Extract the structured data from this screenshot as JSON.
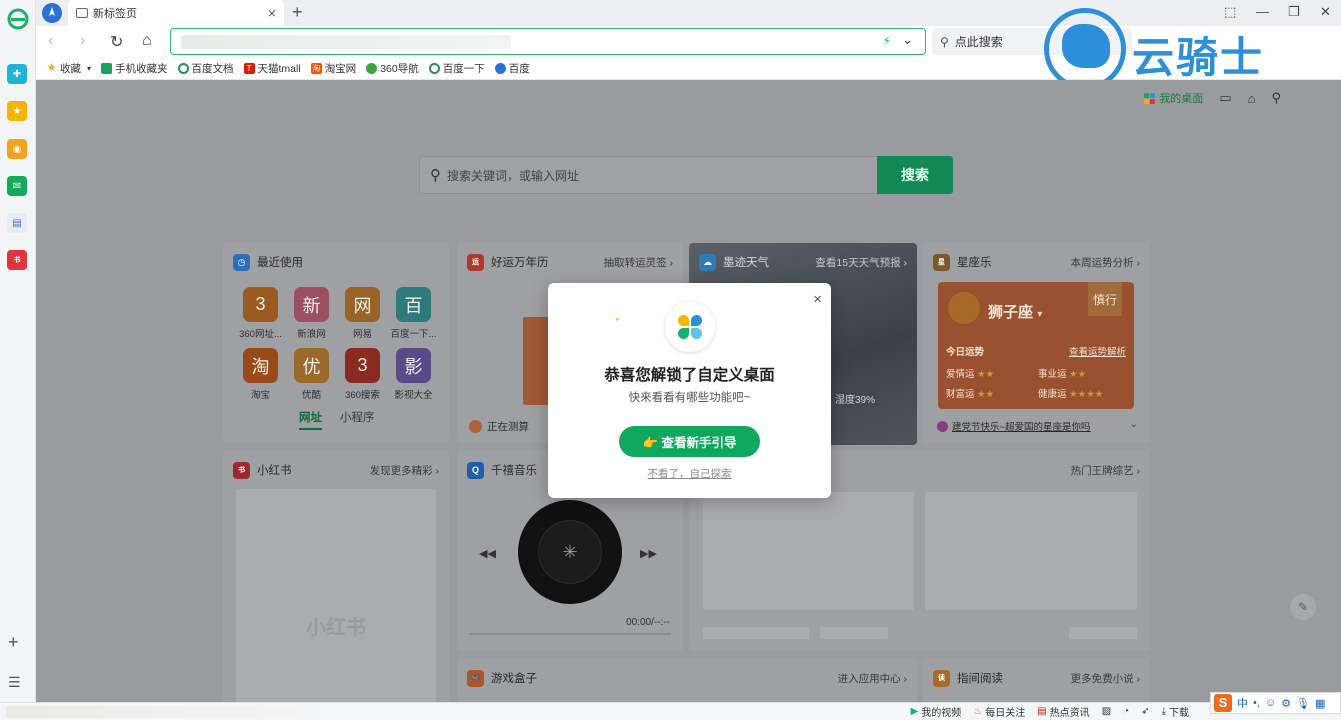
{
  "window": {
    "tab_title": "新标签页",
    "tab_close": "×",
    "new_tab": "+",
    "controls": [
      "⬚",
      "—",
      "❐",
      "✕"
    ]
  },
  "nav": {
    "back": "‹",
    "forward": "›",
    "reload": "↻",
    "home": "⌂",
    "search_placeholder": "点此搜索"
  },
  "watermark": {
    "text": "云骑士"
  },
  "bookmarks": [
    {
      "label": "收藏",
      "icon": "star-icon",
      "color": "#f5a623"
    },
    {
      "label": "手机收藏夹",
      "icon": "phone-icon",
      "color": "#1aa35a"
    },
    {
      "label": "百度文档",
      "icon": "baidu-doc-icon",
      "color": "#2e8b57"
    },
    {
      "label": "天猫tmall",
      "icon": "tmall-icon",
      "color": "#d81e06"
    },
    {
      "label": "淘宝网",
      "icon": "taobao-icon",
      "color": "#ff5000"
    },
    {
      "label": "360导航",
      "icon": "360-nav-icon",
      "color": "#3aa540"
    },
    {
      "label": "百度一下",
      "icon": "baidu-icon",
      "color": "#2e8b57"
    },
    {
      "label": "百度",
      "icon": "baidu-paw-icon",
      "color": "#2d6fd8"
    }
  ],
  "desk": {
    "my_desktop": "我的桌面",
    "search_placeholder": "搜索关键词，或输入网址",
    "search_button": "搜索"
  },
  "cards": {
    "recent": {
      "title": "最近使用",
      "sites": [
        {
          "char": "3",
          "name": "360网址...",
          "color": "#9a5a20"
        },
        {
          "char": "新",
          "name": "新浪网",
          "color": "#9a5062"
        },
        {
          "char": "网",
          "name": "网易",
          "color": "#9a6428"
        },
        {
          "char": "百",
          "name": "百度一下...",
          "color": "#2f7a7a"
        },
        {
          "char": "淘",
          "name": "淘宝",
          "color": "#9a4a18"
        },
        {
          "char": "优",
          "name": "优酷",
          "color": "#9a6a2a"
        },
        {
          "char": "3",
          "name": "360搜索",
          "color": "#8a2a20"
        },
        {
          "char": "影",
          "name": "影视大全",
          "color": "#5a4a8a"
        }
      ],
      "tab_sites": "网址",
      "tab_apps": "小程序"
    },
    "calendar": {
      "title": "好运万年历",
      "link": "抽取转运灵签 ›",
      "footer": "正在测算"
    },
    "weather": {
      "title": "墨迹天气",
      "link": "查看15天天气预报 ›",
      "humidity": "湿度39%"
    },
    "horoscope": {
      "title": "星座乐",
      "link": "本周运势分析 ›",
      "sign": "狮子座",
      "badge": "慎行",
      "today": "今日运势",
      "detail_link": "查看运势解析",
      "love": "爱情运",
      "career": "事业运",
      "wealth": "财富运",
      "health": "健康运",
      "love_stars": 2,
      "career_stars": 2,
      "wealth_stars": 2,
      "health_stars": 4,
      "news": "建党节快乐~超爱国的星座是你吗"
    },
    "xiaohongshu": {
      "title": "小红书",
      "link": "发现更多精彩 ›",
      "watermark": "小红书"
    },
    "music": {
      "title": "千禧音乐",
      "time": "00:00/--:--",
      "prev": "◀◀",
      "next": "▶▶"
    },
    "variety": {
      "link": "热门王牌综艺 ›"
    },
    "games": {
      "title": "游戏盒子",
      "link": "进入应用中心 ›"
    },
    "reading": {
      "title": "指间阅读",
      "link": "更多免费小说 ›"
    }
  },
  "modal": {
    "title": "恭喜您解锁了自定义桌面",
    "subtitle": "快来看看有哪些功能吧~",
    "primary_button": "👉 查看新手引导",
    "secondary_link": "不看了，自己探索",
    "close": "×"
  },
  "statusbar": {
    "items": [
      "我的视频",
      "每日关注",
      "热点资讯",
      "下载"
    ]
  },
  "ime": {
    "logo": "S",
    "mode": "中"
  },
  "colors": {
    "accent": "#0fa95e",
    "url_border": "#2bb870",
    "watermark": "#2d8fd8"
  }
}
